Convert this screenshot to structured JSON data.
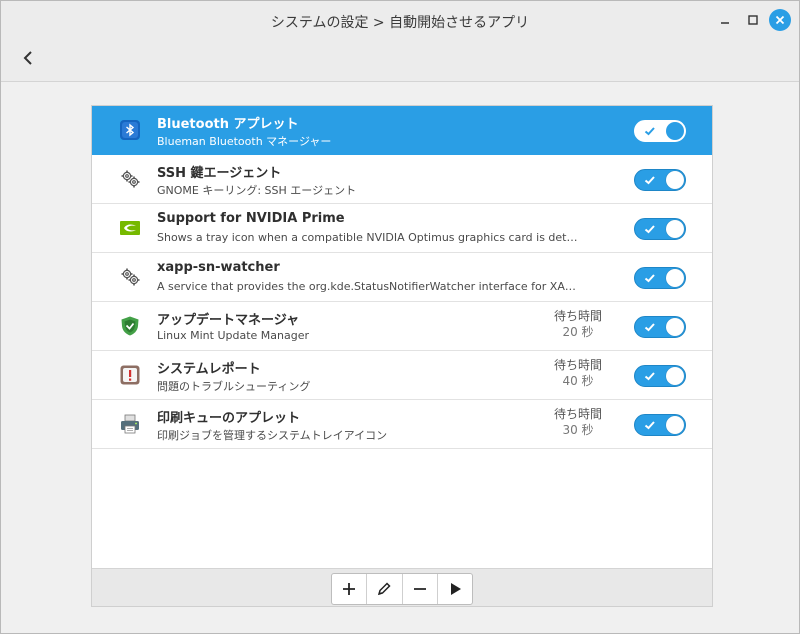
{
  "window": {
    "title": "システムの設定 > 自動開始させるアプリ"
  },
  "header": {
    "back_icon": "chevron-left-icon"
  },
  "accent_color": "#2a9ee5",
  "apps": [
    {
      "name": "Bluetooth アプレット",
      "description": "Blueman Bluetooth マネージャー",
      "icon": "bluetooth-icon",
      "delay_label": "",
      "delay_value": "",
      "enabled": true,
      "selected": true
    },
    {
      "name": "SSH 鍵エージェント",
      "description": "GNOME キーリング: SSH エージェント",
      "icon": "gears-icon",
      "delay_label": "",
      "delay_value": "",
      "enabled": true,
      "selected": false
    },
    {
      "name": "Support for NVIDIA Prime",
      "description": "Shows a tray icon when a compatible NVIDIA Optimus graphics card is det…",
      "icon": "nvidia-icon",
      "delay_label": "",
      "delay_value": "",
      "enabled": true,
      "selected": false
    },
    {
      "name": "xapp-sn-watcher",
      "description": "A service that provides the org.kde.StatusNotifierWatcher interface for XA…",
      "icon": "gears-icon",
      "delay_label": "",
      "delay_value": "",
      "enabled": true,
      "selected": false
    },
    {
      "name": "アップデートマネージャ",
      "description": "Linux Mint Update Manager",
      "icon": "shield-icon",
      "delay_label": "待ち時間",
      "delay_value": "20 秒",
      "enabled": true,
      "selected": false
    },
    {
      "name": "システムレポート",
      "description": "問題のトラブルシューティング",
      "icon": "report-icon",
      "delay_label": "待ち時間",
      "delay_value": "40 秒",
      "enabled": true,
      "selected": false
    },
    {
      "name": "印刷キューのアプレット",
      "description": "印刷ジョブを管理するシステムトレイアイコン",
      "icon": "printer-icon",
      "delay_label": "待ち時間",
      "delay_value": "30 秒",
      "enabled": true,
      "selected": false
    }
  ],
  "toolbar": {
    "buttons": [
      "add-icon",
      "edit-icon",
      "remove-icon",
      "run-icon"
    ]
  }
}
